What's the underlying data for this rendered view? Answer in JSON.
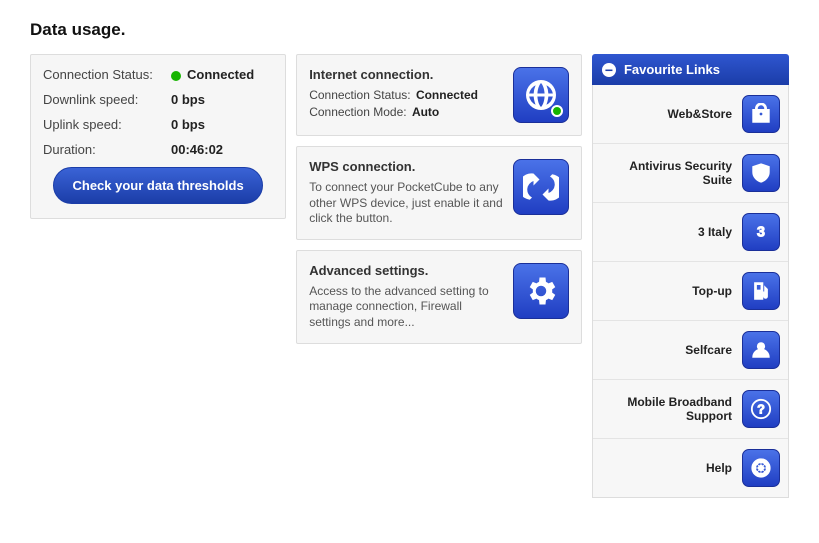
{
  "page": {
    "title": "Data usage."
  },
  "status_panel": {
    "rows": {
      "conn_status_label": "Connection Status:",
      "conn_status_value": "Connected",
      "downlink_label": "Downlink speed:",
      "downlink_value": "0 bps",
      "uplink_label": "Uplink speed:",
      "uplink_value": "0 bps",
      "duration_label": "Duration:",
      "duration_value": "00:46:02"
    },
    "button_label": "Check your data thresholds"
  },
  "tiles": {
    "internet": {
      "title": "Internet connection.",
      "status_label": "Connection Status:",
      "status_value": "Connected",
      "mode_label": "Connection Mode:",
      "mode_value": "Auto"
    },
    "wps": {
      "title": "WPS connection.",
      "desc": "To connect your PocketCube to any other WPS device, just enable it and click the button."
    },
    "advanced": {
      "title": "Advanced settings.",
      "desc": "Access to the advanced setting to manage connection, Firewall settings and more..."
    }
  },
  "favourites": {
    "header": "Favourite Links",
    "items": [
      {
        "label": "Web&Store",
        "icon": "bag-icon"
      },
      {
        "label": "Antivirus Security Suite",
        "icon": "shield-icon"
      },
      {
        "label": "3 Italy",
        "icon": "three-icon"
      },
      {
        "label": "Top-up",
        "icon": "fuel-icon"
      },
      {
        "label": "Selfcare",
        "icon": "user-card-icon"
      },
      {
        "label": "Mobile Broadband Support",
        "icon": "question-icon"
      },
      {
        "label": "Help",
        "icon": "lifebuoy-icon"
      }
    ]
  }
}
